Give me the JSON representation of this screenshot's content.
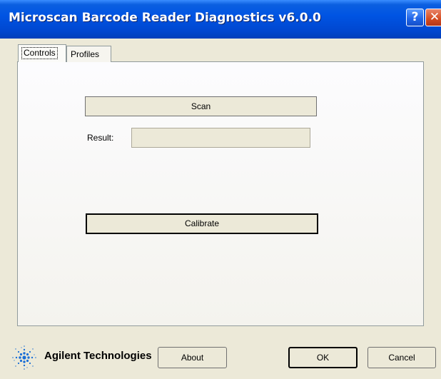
{
  "window": {
    "title": "Microscan Barcode Reader Diagnostics v6.0.0",
    "help_label": "?",
    "close_label": "✕"
  },
  "tabs": [
    {
      "label": "Controls",
      "selected": true
    },
    {
      "label": "Profiles",
      "selected": false
    }
  ],
  "controls": {
    "scan_label": "Scan",
    "result_label": "Result:",
    "result_value": "",
    "calibrate_label": "Calibrate"
  },
  "footer": {
    "logo_text": "Agilent Technologies",
    "about_label": "About",
    "ok_label": "OK",
    "cancel_label": "Cancel"
  },
  "colors": {
    "titlebar": "#0054e3",
    "face": "#ece9d8",
    "logo_blue": "#1b6fd6"
  },
  "icons": {
    "help": "help-icon",
    "close": "close-icon",
    "logo": "agilent-spark-icon"
  }
}
